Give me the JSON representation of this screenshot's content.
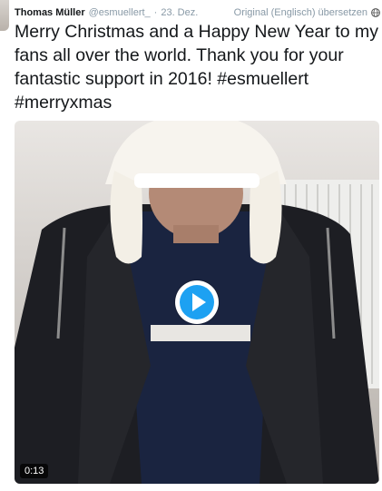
{
  "tweet": {
    "author_name": "Thomas Müller",
    "handle": "@esmuellert_",
    "separator": "·",
    "date": "23. Dez.",
    "translate_label": "Original (Englisch) übersetzen",
    "text": "Merry Christmas and a Happy New Year to my fans all over the world. Thank you for your fantastic support in 2016! #esmuellert #merryxmas"
  },
  "video": {
    "duration": "0:13",
    "play_icon": "play-icon",
    "accent_color": "#1da1f2"
  }
}
